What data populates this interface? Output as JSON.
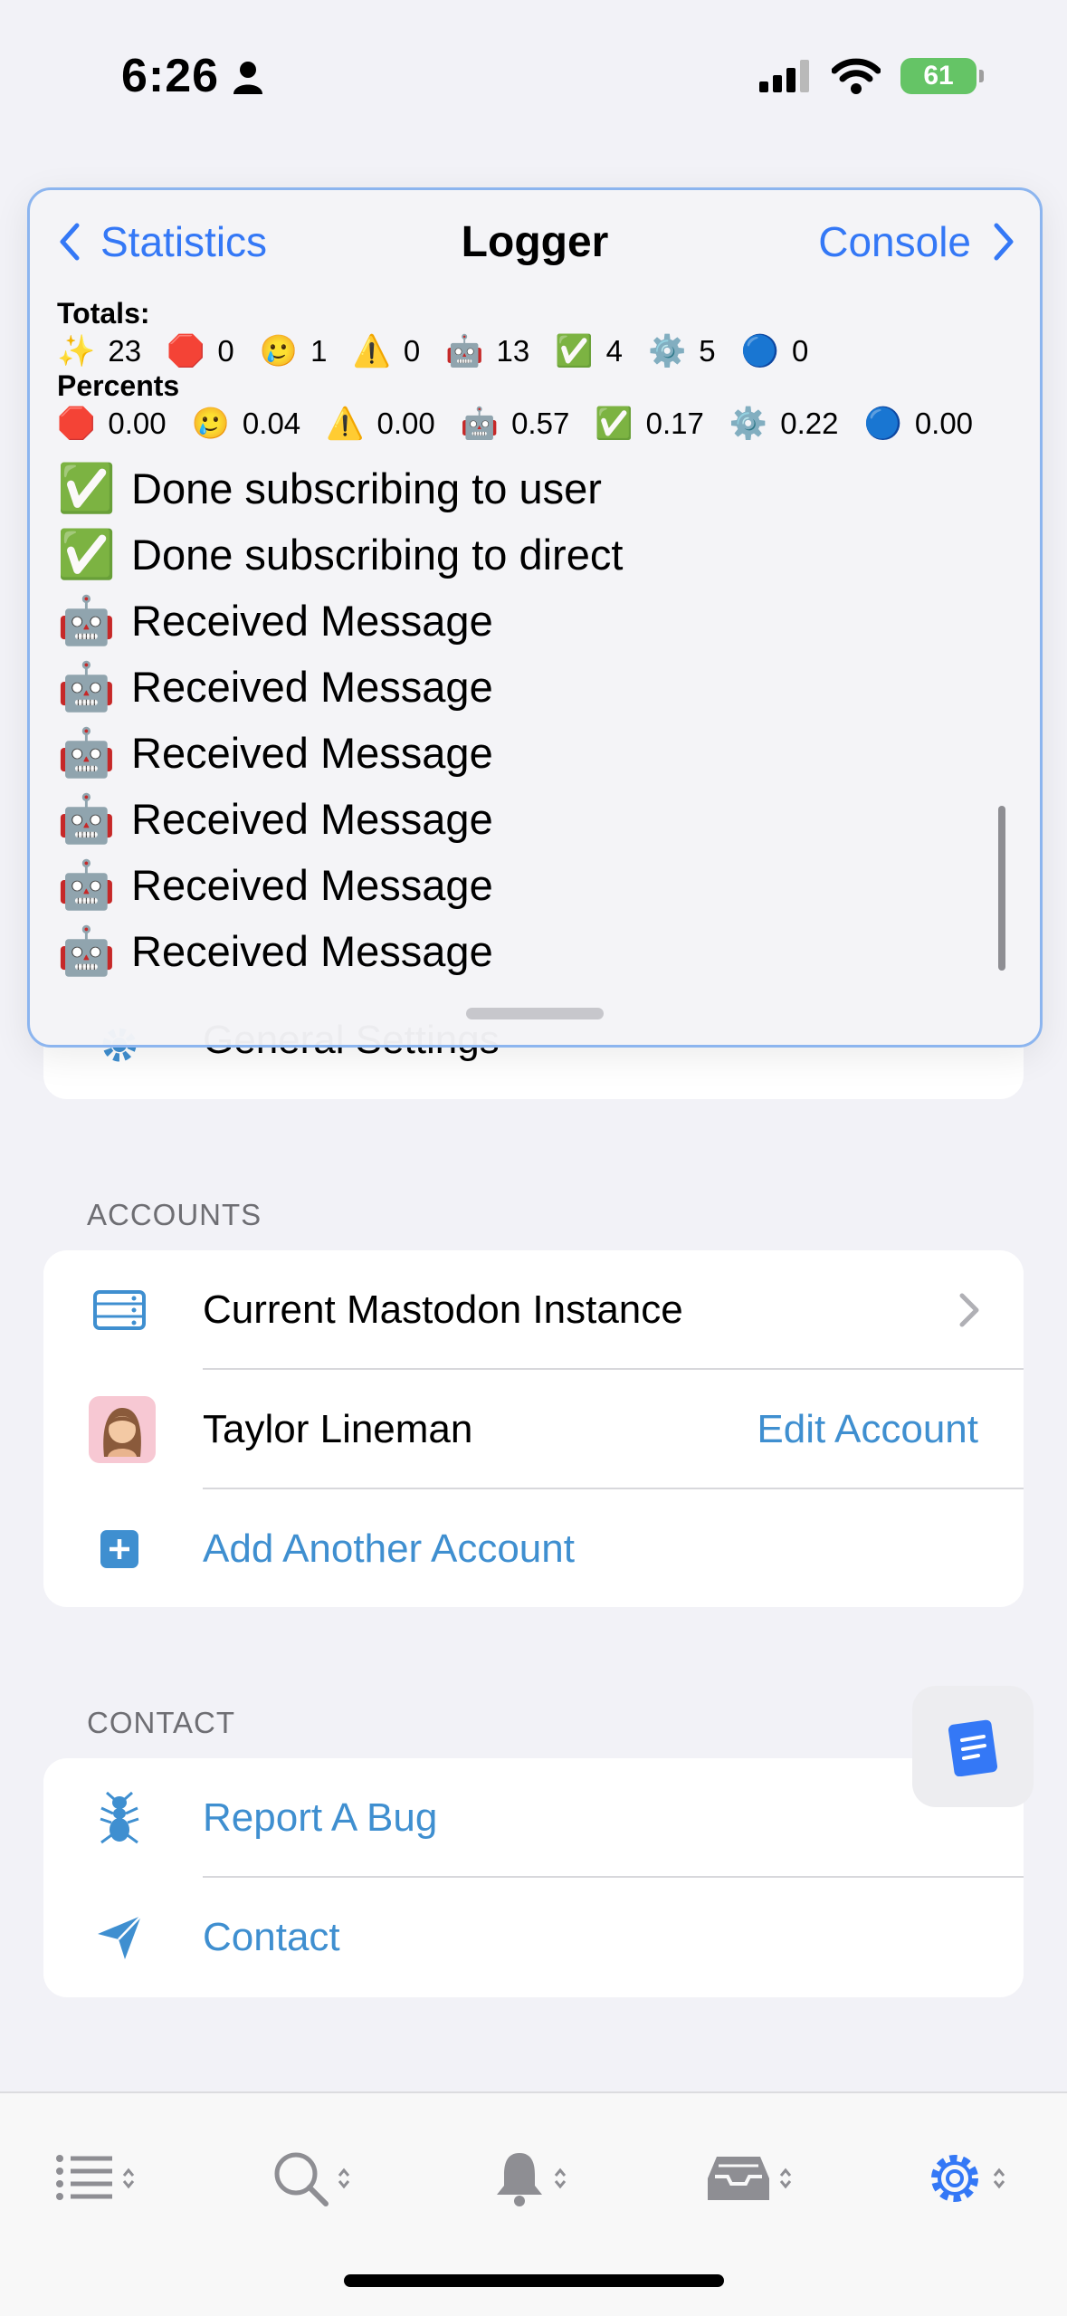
{
  "status_bar": {
    "time": "6:26",
    "battery": "61"
  },
  "settings": {
    "general_row": "General Settings",
    "accounts_header": "ACCOUNTS",
    "accounts": [
      {
        "label": "Current Mastodon Instance"
      },
      {
        "label": "Taylor Lineman",
        "action": "Edit Account"
      },
      {
        "label": "Add Another Account"
      }
    ],
    "contact_header": "CONTACT",
    "contact": [
      {
        "label": "Report A Bug"
      },
      {
        "label": "Contact"
      }
    ]
  },
  "logger": {
    "back_label": "Statistics",
    "title": "Logger",
    "console_label": "Console",
    "totals_label": "Totals:",
    "totals": [
      {
        "icon": "✨",
        "value": "23"
      },
      {
        "icon": "🛑",
        "value": "0"
      },
      {
        "icon": "🥲",
        "value": "1"
      },
      {
        "icon": "⚠️",
        "value": "0"
      },
      {
        "icon": "🤖",
        "value": "13"
      },
      {
        "icon": "✅",
        "value": "4"
      },
      {
        "icon": "⚙️",
        "value": "5"
      },
      {
        "icon": "🔵",
        "value": "0"
      }
    ],
    "percents_label": "Percents",
    "percents": [
      {
        "icon": "🛑",
        "value": "0.00"
      },
      {
        "icon": "🥲",
        "value": "0.04"
      },
      {
        "icon": "⚠️",
        "value": "0.00"
      },
      {
        "icon": "🤖",
        "value": "0.57"
      },
      {
        "icon": "✅",
        "value": "0.17"
      },
      {
        "icon": "⚙️",
        "value": "0.22"
      },
      {
        "icon": "🔵",
        "value": "0.00"
      }
    ],
    "entries": [
      {
        "icon": "✅",
        "text": "Done subscribing to user"
      },
      {
        "icon": "✅",
        "text": "Done subscribing to direct"
      },
      {
        "icon": "🤖",
        "text": "Received Message"
      },
      {
        "icon": "🤖",
        "text": "Received Message"
      },
      {
        "icon": "🤖",
        "text": "Received Message"
      },
      {
        "icon": "🤖",
        "text": "Received Message"
      },
      {
        "icon": "🤖",
        "text": "Received Message"
      },
      {
        "icon": "🤖",
        "text": "Received Message"
      }
    ]
  },
  "colors": {
    "accent": "#3f8fd0",
    "logger_accent": "#3478f6",
    "logger_border": "#8cb5ef"
  },
  "tab_bar": {
    "tabs": [
      {
        "icon": "timeline-list-icon"
      },
      {
        "icon": "search-icon"
      },
      {
        "icon": "bell-icon"
      },
      {
        "icon": "inbox-tray-icon"
      },
      {
        "icon": "gear-icon",
        "selected": true
      }
    ]
  }
}
